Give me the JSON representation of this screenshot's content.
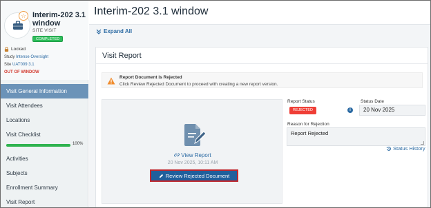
{
  "visit": {
    "title": "Interim-202 3.1 window",
    "type": "SITE VISIT",
    "status_badge": "COMPLETED",
    "locked_label": "Locked",
    "study_label": "Study",
    "study_value": "Intense Oversight",
    "site_label": "Site",
    "site_value": "UAT009 3.1",
    "window_status": "OUT OF WINDOW"
  },
  "nav": {
    "items": [
      {
        "label": "Visit General Information",
        "active": true
      },
      {
        "label": "Visit Attendees"
      },
      {
        "label": "Locations"
      },
      {
        "label": "Visit Checklist",
        "progress": 100,
        "progress_label": "100%"
      },
      {
        "label": "Activities"
      },
      {
        "label": "Subjects"
      },
      {
        "label": "Enrollment Summary"
      },
      {
        "label": "Visit Report"
      }
    ]
  },
  "header": {
    "title": "Interim-202 3.1 window",
    "expand_all": "Expand All"
  },
  "report": {
    "section_title": "Visit Report",
    "alert_title": "Report Document is Rejected",
    "alert_message": "Click Review Rejected Document to proceed with creating a new report version.",
    "view_report": "View Report",
    "report_date": "20 Nov 2025, 10:11 AM",
    "review_button": "Review Rejected Document",
    "status_label": "Report Status",
    "status_value": "REJECTED",
    "status_date_label": "Status Date",
    "status_date_value": "20 Nov 2025",
    "reason_label": "Reason for Rejection",
    "reason_value": "Report Rejected",
    "status_history": "Status History"
  },
  "colors": {
    "accent": "#2b6aa3",
    "active_nav": "#6b93b8",
    "completed": "#2dbd5a",
    "rejected": "#ef3e36",
    "out_of_window": "#d33a2f",
    "primary_button": "#1f5f9c"
  },
  "icons": [
    "briefcase-icon",
    "star-icon",
    "lock-icon",
    "chevrons-down-icon",
    "warning-icon",
    "document-edit-icon",
    "link-icon",
    "pencil-icon",
    "info-icon",
    "history-icon"
  ]
}
